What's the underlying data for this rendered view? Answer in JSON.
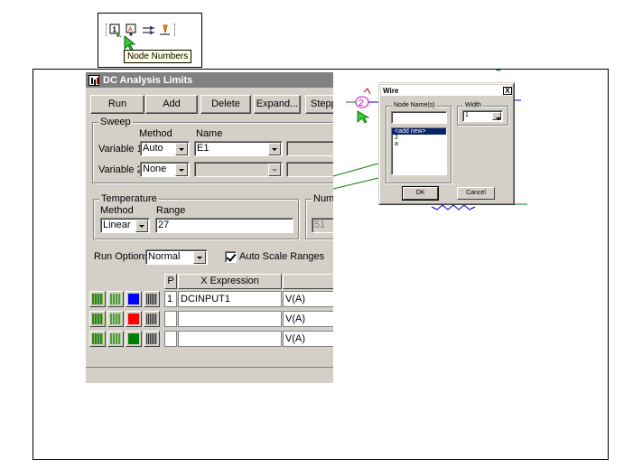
{
  "toolbar_snippet": {
    "icons": [
      "node-number-icon",
      "node-number-alt-icon",
      "wire-split-icon",
      "place-text-icon"
    ],
    "tooltip": "Node Numbers"
  },
  "dc_window": {
    "title": "DC Analysis Limits",
    "buttons": {
      "run": "Run",
      "add": "Add",
      "delete": "Delete",
      "expand": "Expand...",
      "stepping": "Stepp"
    },
    "sweep": {
      "group_label": "Sweep",
      "method_header": "Method",
      "name_header": "Name",
      "variable1": {
        "label": "Variable 1",
        "method": "Auto",
        "name": "E1"
      },
      "variable2": {
        "label": "Variable 2",
        "method": "None",
        "name": ""
      }
    },
    "temperature": {
      "group_label": "Temperature",
      "method_header": "Method",
      "range_header": "Range",
      "method": "Linear",
      "range": "27"
    },
    "number_points": {
      "group_label": "Numb",
      "value": "51"
    },
    "run_options": {
      "label": "Run Options",
      "value": "Normal"
    },
    "auto_scale": {
      "label": "Auto Scale Ranges",
      "checked": true
    },
    "table": {
      "headers": {
        "p": "P",
        "x_expression": "X Expression"
      },
      "rows": [
        {
          "p": "1",
          "x_expression": "DCINPUT1",
          "y_expression": "V(A)",
          "color": "#0000ff"
        },
        {
          "p": "",
          "x_expression": "",
          "y_expression": "V(A)",
          "color": "#ff0000"
        },
        {
          "p": "",
          "x_expression": "",
          "y_expression": "V(A)",
          "color": "#008000"
        }
      ]
    }
  },
  "schematic": {
    "node_label": "2"
  },
  "wire_dialog": {
    "title": "Wire",
    "close_label": "X",
    "node_names_label": "Node Name(s)",
    "node_names_value": "",
    "width_label": "Width",
    "width_value": "1",
    "list_items": [
      "<add new>",
      "2",
      "a"
    ],
    "ok_label": "OK",
    "cancel_label": "Cancel"
  },
  "colors": {
    "wire_green": "#008000",
    "node_magenta": "#cc00cc",
    "wire_blue": "#0000cc",
    "selection_blue": "#0a246a"
  }
}
